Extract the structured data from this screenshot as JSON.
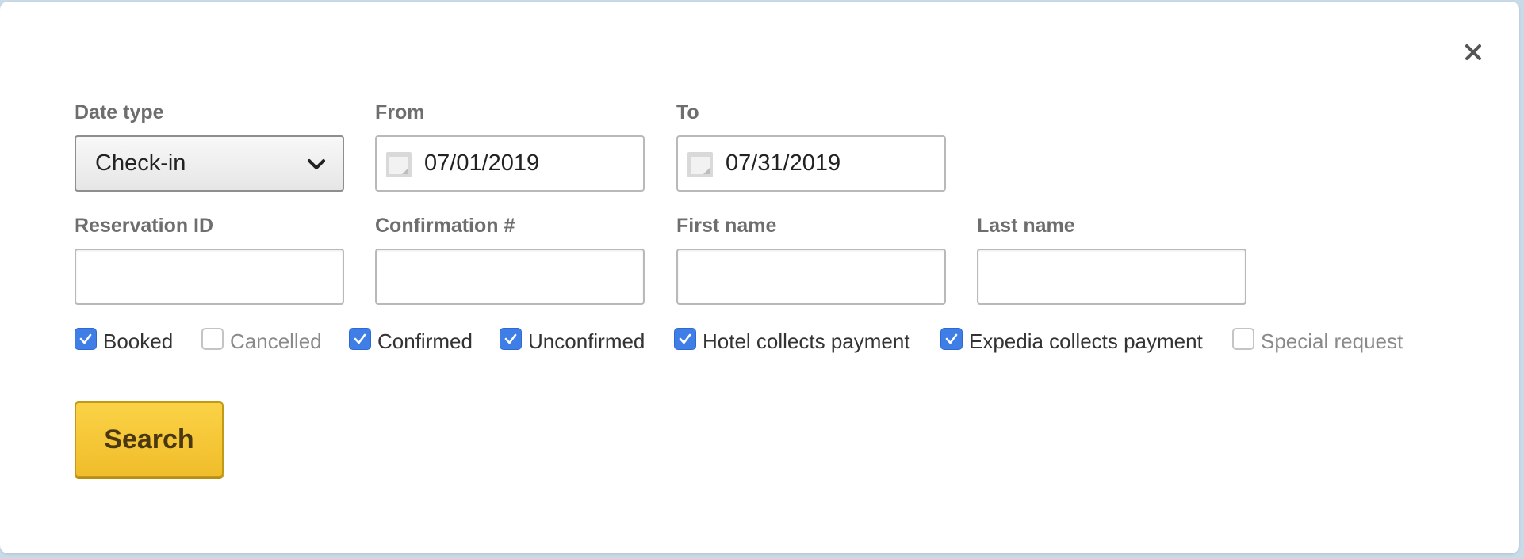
{
  "dialog": {
    "close_icon": "close-icon",
    "close_glyph": "✕"
  },
  "date_type": {
    "label": "Date type",
    "selected": "Check-in",
    "icon": "chevron-down-icon"
  },
  "from": {
    "label": "From",
    "value": "07/01/2019",
    "icon": "calendar-icon"
  },
  "to": {
    "label": "To",
    "value": "07/31/2019",
    "icon": "calendar-icon"
  },
  "reservation_id": {
    "label": "Reservation ID",
    "value": ""
  },
  "confirmation": {
    "label": "Confirmation #",
    "value": ""
  },
  "first_name": {
    "label": "First name",
    "value": ""
  },
  "last_name": {
    "label": "Last name",
    "value": ""
  },
  "filters": [
    {
      "label": "Booked",
      "checked": true
    },
    {
      "label": "Cancelled",
      "checked": false
    },
    {
      "label": "Confirmed",
      "checked": true
    },
    {
      "label": "Unconfirmed",
      "checked": true
    },
    {
      "label": "Hotel collects payment",
      "checked": true
    },
    {
      "label": "Expedia collects payment",
      "checked": true
    },
    {
      "label": "Special request",
      "checked": false
    }
  ],
  "search_button": {
    "label": "Search"
  },
  "colors": {
    "accent_checkbox": "#3e7ee6",
    "search_button": "#f5c637",
    "backdrop": "#c9dbe9"
  }
}
